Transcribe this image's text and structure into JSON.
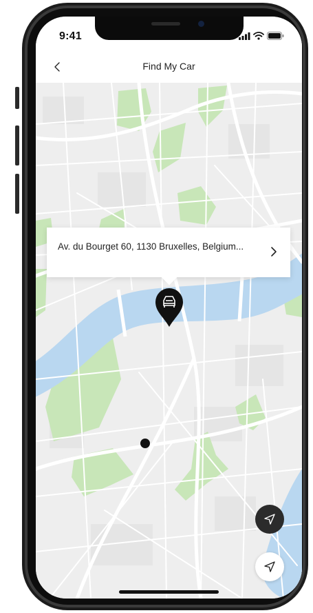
{
  "status_bar": {
    "time": "9:41",
    "icons": [
      "cellular-signal-icon",
      "wifi-icon",
      "battery-icon"
    ]
  },
  "header": {
    "back_icon": "chevron-left-icon",
    "title": "Find My Car"
  },
  "map": {
    "colors": {
      "land": "#eeeeee",
      "block": "#e6e6e6",
      "road": "#ffffff",
      "water": "#b9d7f0",
      "park": "#c8e6b8"
    }
  },
  "address_card": {
    "address": "Av. du Bourget 60, 1130 Bruxelles, Belgium...",
    "chevron_icon": "chevron-right-icon"
  },
  "car_pin": {
    "icon": "car-icon",
    "color": "#111111"
  },
  "controls": {
    "navigate_dark_icon": "navigation-arrow-icon",
    "navigate_light_icon": "location-arrow-icon"
  }
}
